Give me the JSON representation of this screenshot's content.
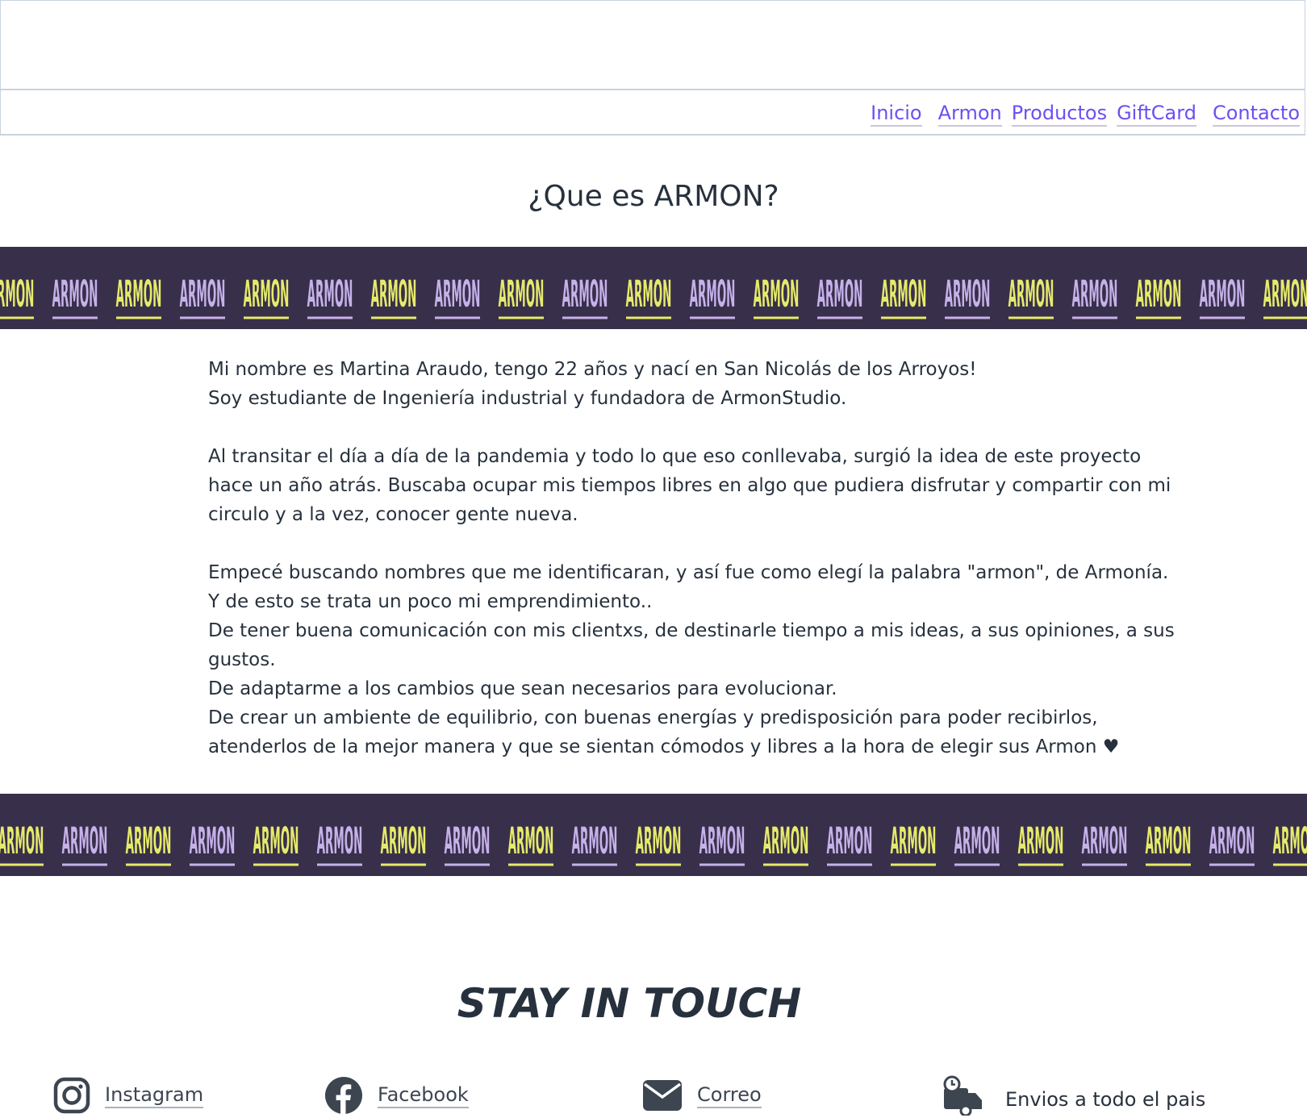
{
  "nav": {
    "items": [
      {
        "label": "Inicio"
      },
      {
        "label": "Armon"
      },
      {
        "label": "Productos"
      },
      {
        "label": "GiftCard"
      },
      {
        "label": "Contacto"
      }
    ]
  },
  "main": {
    "title": "¿Que es ARMON?",
    "banner_word": "ARMON",
    "paragraphs": [
      [
        "Mi nombre es Martina Araudo, tengo 22 años y nací en San Nicolás de los Arroyos!",
        "Soy estudiante de Ingeniería industrial y fundadora de ArmonStudio."
      ],
      [
        "Al transitar el día a día de la pandemia y todo lo que eso conllevaba, surgió la idea de este proyecto hace un año atrás. Buscaba ocupar mis tiempos libres en algo que pudiera disfrutar y compartir con mi circulo y a la vez, conocer gente nueva."
      ],
      [
        "Empecé buscando nombres que me identificaran, y así fue como elegí la palabra \"armon\", de Armonía.",
        "Y de esto se trata un poco mi emprendimiento..",
        "De tener buena comunicación con mis clientxs, de destinarle tiempo a mis ideas, a sus opiniones, a sus gustos.",
        "De adaptarme a los cambios que sean necesarios para evolucionar.",
        "De crear un ambiente de equilibrio, con buenas energías y predisposición para poder recibirlos, atenderlos de la mejor manera y que se sientan cómodos y libres a la hora de elegir sus Armon ♥"
      ]
    ]
  },
  "footer": {
    "heading": "STAY IN TOUCH",
    "links": {
      "instagram": "Instagram",
      "facebook": "Facebook",
      "correo": "Correo",
      "envios": "Envios a todo el pais"
    },
    "icons": [
      "instagram-icon",
      "facebook-icon",
      "mail-icon",
      "delivery-truck-icon"
    ]
  },
  "colors": {
    "nav_link": "#6e4ff0",
    "band_background": "#38304a",
    "band_yellow": "#e6ea6b",
    "band_purple": "#c6b1ea",
    "text": "#27313d"
  }
}
